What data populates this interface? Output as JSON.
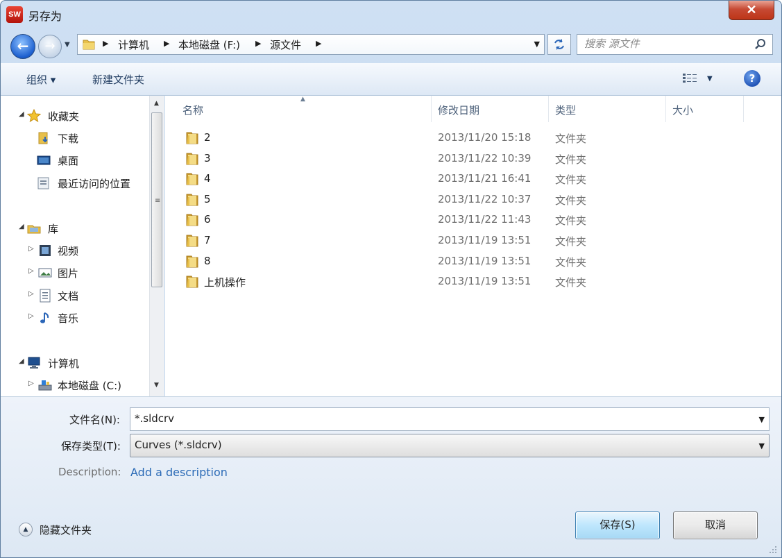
{
  "window": {
    "title": "另存为",
    "app_icon_text": "SW",
    "close_label": "✕"
  },
  "navbar": {
    "back_glyph": "←",
    "forward_glyph": "→",
    "breadcrumbs": [
      "计算机",
      "本地磁盘 (F:)",
      "源文件"
    ],
    "search_placeholder": "搜索 源文件"
  },
  "toolbar": {
    "organize_label": "组织 ▾",
    "new_folder_label": "新建文件夹",
    "help_label": "?"
  },
  "nav_pane": {
    "favorites": {
      "label": "收藏夹",
      "items": [
        "下载",
        "桌面",
        "最近访问的位置"
      ]
    },
    "libraries": {
      "label": "库",
      "items": [
        "视频",
        "图片",
        "文档",
        "音乐"
      ]
    },
    "computer": {
      "label": "计算机",
      "items": [
        "本地磁盘 (C:)"
      ]
    }
  },
  "file_list": {
    "columns": [
      "名称",
      "修改日期",
      "类型",
      "大小"
    ],
    "rows": [
      {
        "name": "2",
        "date": "2013/11/20 15:18",
        "type": "文件夹"
      },
      {
        "name": "3",
        "date": "2013/11/22 10:39",
        "type": "文件夹"
      },
      {
        "name": "4",
        "date": "2013/11/21 16:41",
        "type": "文件夹"
      },
      {
        "name": "5",
        "date": "2013/11/22 10:37",
        "type": "文件夹"
      },
      {
        "name": "6",
        "date": "2013/11/22 11:43",
        "type": "文件夹"
      },
      {
        "name": "7",
        "date": "2013/11/19 13:51",
        "type": "文件夹"
      },
      {
        "name": "8",
        "date": "2013/11/19 13:51",
        "type": "文件夹"
      },
      {
        "name": "上机操作",
        "date": "2013/11/19 13:51",
        "type": "文件夹"
      }
    ]
  },
  "form": {
    "filename_label": "文件名(N):",
    "filename_value": "*.sldcrv",
    "filetype_label": "保存类型(T):",
    "filetype_value": "Curves (*.sldcrv)",
    "description_label": "Description:",
    "description_link": "Add a description"
  },
  "footer": {
    "hide_folders_label": "隐藏文件夹",
    "save_label": "保存(S)",
    "cancel_label": "取消"
  },
  "colors": {
    "folder_yellow": "#e8c04a",
    "link_blue": "#2a6ab6",
    "frame_blue": "#bcd3ee"
  }
}
